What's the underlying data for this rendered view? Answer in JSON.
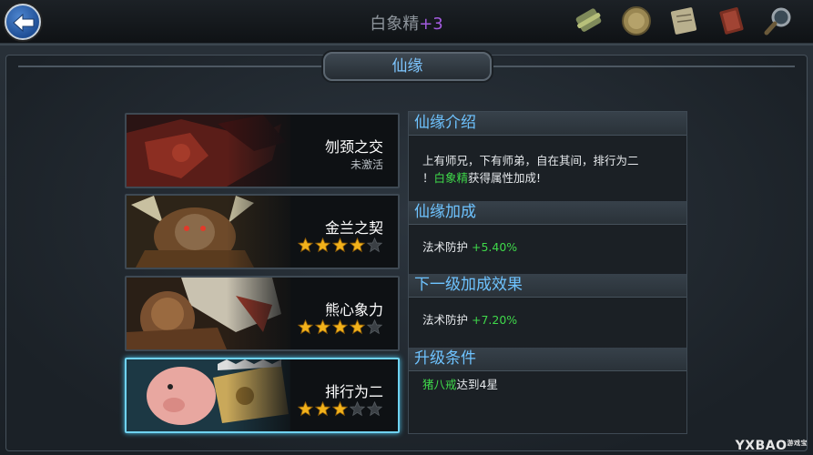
{
  "header": {
    "title": "白象精",
    "plus": "+3"
  },
  "section": {
    "title": "仙缘"
  },
  "cards": [
    {
      "name": "刎颈之交",
      "status": "未激活",
      "stars": null
    },
    {
      "name": "金兰之契",
      "status": null,
      "stars": 4,
      "max_stars": 5
    },
    {
      "name": "熊心象力",
      "status": null,
      "stars": 4,
      "max_stars": 5
    },
    {
      "name": "排行为二",
      "status": null,
      "stars": 3,
      "max_stars": 5
    }
  ],
  "panel": {
    "intro_title": "仙缘介绍",
    "intro_line1": "上有师兄，下有师弟，自在其间，排行为二",
    "intro_line2_pre": "！",
    "intro_line2_name": "白象精",
    "intro_line2_post": "获得属性加成!",
    "bonus_title": "仙缘加成",
    "bonus_label": "法术防护",
    "bonus_value": "+5.40%",
    "next_title": "下一级加成效果",
    "next_label": "法术防护",
    "next_value": "+7.20%",
    "cond_title": "升级条件",
    "cond_name": "猪八戒",
    "cond_text": "达到4星"
  },
  "watermark": {
    "text": "YXBAO",
    "sub": "游戏宝"
  },
  "colors": {
    "accent_blue": "#6ec3ff",
    "bonus_green": "#3fd84a",
    "plus_purple": "#a45be0",
    "star_gold": "#f2b21b"
  },
  "icons": [
    "scroll-icon",
    "coin-icon",
    "map-icon",
    "book-icon",
    "magnifier-icon"
  ]
}
